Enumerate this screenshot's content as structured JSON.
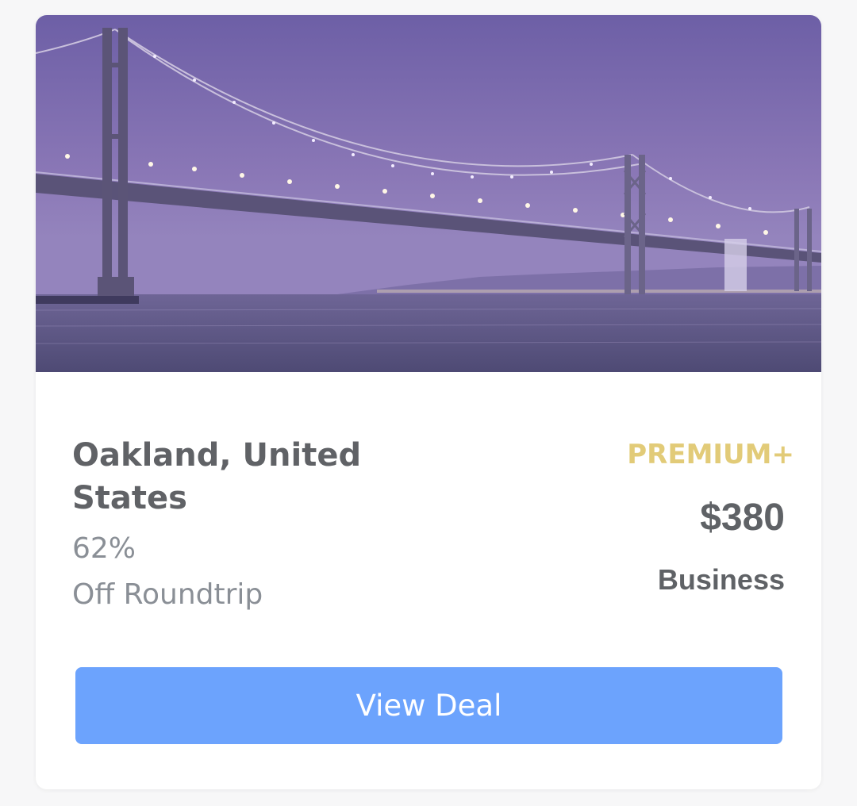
{
  "deal": {
    "image_alt": "Bay Bridge at dusk",
    "destination": "Oakland, United States",
    "discount_percent": "62%",
    "discount_label": "Off Roundtrip",
    "tier": "PREMIUM+",
    "price": "$380",
    "cabin": "Business",
    "cta_label": "View Deal"
  },
  "colors": {
    "accent_button": "#6ca3fd",
    "tier_gold": "#e2cb78",
    "heading_text": "#606266",
    "muted_text": "#8a8f96"
  }
}
